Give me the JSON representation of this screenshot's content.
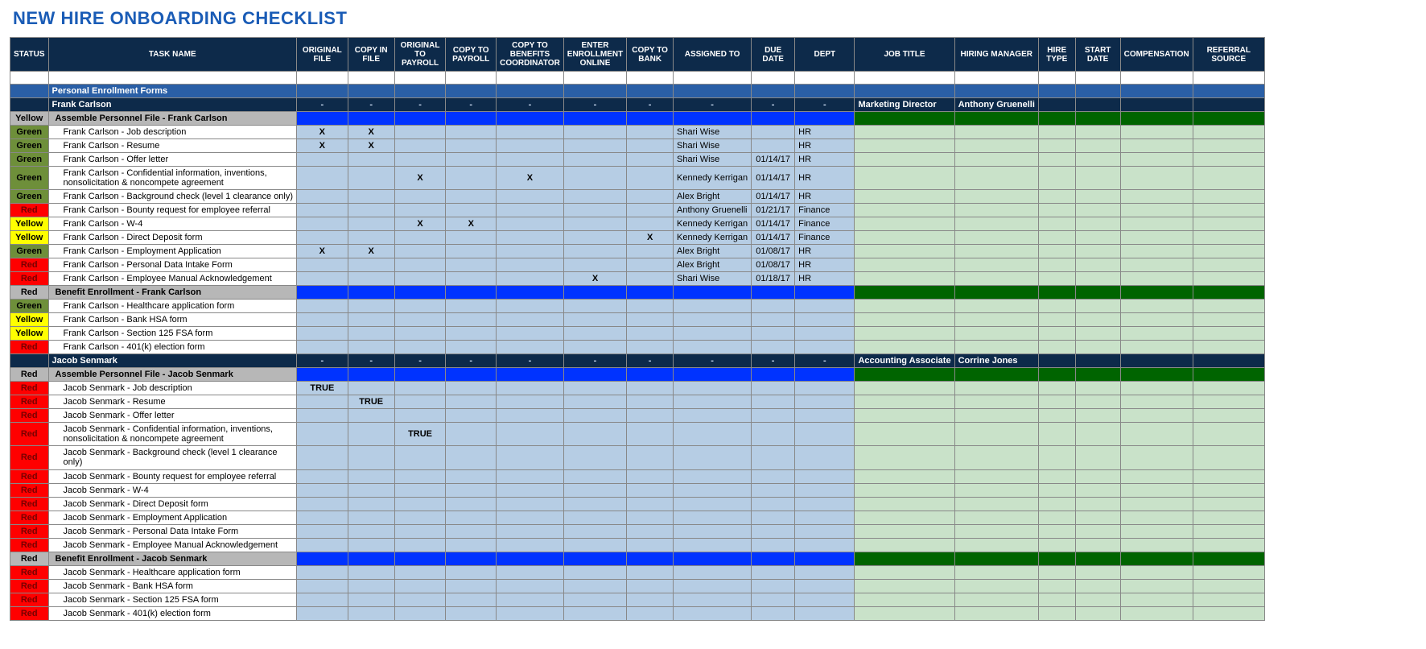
{
  "title": "NEW HIRE ONBOARDING CHECKLIST",
  "headers": [
    "STATUS",
    "TASK NAME",
    "ORIGINAL FILE",
    "COPY IN FILE",
    "ORIGINAL TO PAYROLL",
    "COPY TO PAYROLL",
    "COPY TO BENEFITS COORDINATOR",
    "ENTER ENROLLMENT ONLINE",
    "COPY TO BANK",
    "ASSIGNED TO",
    "DUE DATE",
    "DEPT",
    "JOB TITLE",
    "HIRING MANAGER",
    "HIRE TYPE",
    "START DATE",
    "COMPENSATION",
    "REFERRAL SOURCE"
  ],
  "section_label": "Personal Enrollment Forms",
  "hires": [
    {
      "name": "Frank Carlson",
      "job_title": "Marketing Director",
      "manager": "Anthony Gruenelli",
      "groups": [
        {
          "status": "Yellow",
          "label": "Assemble Personnel File - Frank Carlson",
          "rows": [
            {
              "status": "Green",
              "task": "Frank Carlson - Job description",
              "x": [
                "X",
                "X",
                "",
                "",
                "",
                "",
                ""
              ],
              "assigned": "Shari Wise",
              "date": "",
              "dept": "HR"
            },
            {
              "status": "Green",
              "task": "Frank Carlson - Resume",
              "x": [
                "X",
                "X",
                "",
                "",
                "",
                "",
                ""
              ],
              "assigned": "Shari Wise",
              "date": "",
              "dept": "HR"
            },
            {
              "status": "Green",
              "task": "Frank Carlson - Offer letter",
              "x": [
                "",
                "",
                "",
                "",
                "",
                "",
                ""
              ],
              "assigned": "Shari Wise",
              "date": "01/14/17",
              "dept": "HR"
            },
            {
              "status": "Green",
              "task": "Frank Carlson - Confidential information, inventions, nonsolicitation & noncompete agreement",
              "x": [
                "",
                "",
                "X",
                "",
                "X",
                "",
                ""
              ],
              "assigned": "Kennedy Kerrigan",
              "date": "01/14/17",
              "dept": "HR",
              "wrap": true
            },
            {
              "status": "Green",
              "task": "Frank Carlson - Background check (level 1 clearance only)",
              "x": [
                "",
                "",
                "",
                "",
                "",
                "",
                ""
              ],
              "assigned": "Alex Bright",
              "date": "01/14/17",
              "dept": "HR"
            },
            {
              "status": "Red",
              "task": "Frank Carlson - Bounty request for employee referral",
              "x": [
                "",
                "",
                "",
                "",
                "",
                "",
                ""
              ],
              "assigned": "Anthony Gruenelli",
              "date": "01/21/17",
              "dept": "Finance"
            },
            {
              "status": "Yellow",
              "task": "Frank Carlson - W-4",
              "x": [
                "",
                "",
                "X",
                "X",
                "",
                "",
                ""
              ],
              "assigned": "Kennedy Kerrigan",
              "date": "01/14/17",
              "dept": "Finance"
            },
            {
              "status": "Yellow",
              "task": "Frank Carlson - Direct Deposit form",
              "x": [
                "",
                "",
                "",
                "",
                "",
                "",
                "X"
              ],
              "assigned": "Kennedy Kerrigan",
              "date": "01/14/17",
              "dept": "Finance"
            },
            {
              "status": "Green",
              "task": "Frank Carlson - Employment Application",
              "x": [
                "X",
                "X",
                "",
                "",
                "",
                "",
                ""
              ],
              "assigned": "Alex Bright",
              "date": "01/08/17",
              "dept": "HR"
            },
            {
              "status": "Red",
              "task": "Frank Carlson - Personal Data Intake Form",
              "x": [
                "",
                "",
                "",
                "",
                "",
                "",
                ""
              ],
              "assigned": "Alex Bright",
              "date": "01/08/17",
              "dept": "HR"
            },
            {
              "status": "Red",
              "task": "Frank Carlson - Employee Manual Acknowledgement",
              "x": [
                "",
                "",
                "",
                "",
                "",
                "X",
                ""
              ],
              "assigned": "Shari Wise",
              "date": "01/18/17",
              "dept": "HR"
            }
          ]
        },
        {
          "status": "Red",
          "label": "Benefit Enrollment - Frank Carlson",
          "rows": [
            {
              "status": "Green",
              "task": "Frank Carlson - Healthcare application form",
              "x": [
                "",
                "",
                "",
                "",
                "",
                "",
                ""
              ],
              "assigned": "",
              "date": "",
              "dept": ""
            },
            {
              "status": "Yellow",
              "task": "Frank Carlson - Bank HSA form",
              "x": [
                "",
                "",
                "",
                "",
                "",
                "",
                ""
              ],
              "assigned": "",
              "date": "",
              "dept": ""
            },
            {
              "status": "Yellow",
              "task": "Frank Carlson - Section 125 FSA form",
              "x": [
                "",
                "",
                "",
                "",
                "",
                "",
                ""
              ],
              "assigned": "",
              "date": "",
              "dept": ""
            },
            {
              "status": "Red",
              "task": "Frank Carlson - 401(k) election form",
              "x": [
                "",
                "",
                "",
                "",
                "",
                "",
                ""
              ],
              "assigned": "",
              "date": "",
              "dept": ""
            }
          ]
        }
      ]
    },
    {
      "name": "Jacob Senmark",
      "job_title": "Accounting Associate",
      "manager": "Corrine Jones",
      "groups": [
        {
          "status": "Red",
          "label": "Assemble Personnel File - Jacob Senmark",
          "rows": [
            {
              "status": "Red",
              "task": "Jacob Senmark - Job description",
              "x": [
                "TRUE",
                "",
                "",
                "",
                "",
                "",
                ""
              ],
              "assigned": "",
              "date": "",
              "dept": ""
            },
            {
              "status": "Red",
              "task": "Jacob Senmark - Resume",
              "x": [
                "",
                "TRUE",
                "",
                "",
                "",
                "",
                ""
              ],
              "assigned": "",
              "date": "",
              "dept": ""
            },
            {
              "status": "Red",
              "task": "Jacob Senmark - Offer letter",
              "x": [
                "",
                "",
                "",
                "",
                "",
                "",
                ""
              ],
              "assigned": "",
              "date": "",
              "dept": ""
            },
            {
              "status": "Red",
              "task": "Jacob Senmark - Confidential information, inventions, nonsolicitation & noncompete agreement",
              "x": [
                "",
                "",
                "TRUE",
                "",
                "",
                "",
                ""
              ],
              "assigned": "",
              "date": "",
              "dept": "",
              "wrap": true
            },
            {
              "status": "Red",
              "task": "Jacob Senmark - Background check (level 1 clearance only)",
              "x": [
                "",
                "",
                "",
                "",
                "",
                "",
                ""
              ],
              "assigned": "",
              "date": "",
              "dept": "",
              "wrap": true
            },
            {
              "status": "Red",
              "task": "Jacob Senmark - Bounty request for employee referral",
              "x": [
                "",
                "",
                "",
                "",
                "",
                "",
                ""
              ],
              "assigned": "",
              "date": "",
              "dept": ""
            },
            {
              "status": "Red",
              "task": "Jacob Senmark - W-4",
              "x": [
                "",
                "",
                "",
                "",
                "",
                "",
                ""
              ],
              "assigned": "",
              "date": "",
              "dept": ""
            },
            {
              "status": "Red",
              "task": "Jacob Senmark - Direct Deposit form",
              "x": [
                "",
                "",
                "",
                "",
                "",
                "",
                ""
              ],
              "assigned": "",
              "date": "",
              "dept": ""
            },
            {
              "status": "Red",
              "task": "Jacob Senmark - Employment Application",
              "x": [
                "",
                "",
                "",
                "",
                "",
                "",
                ""
              ],
              "assigned": "",
              "date": "",
              "dept": ""
            },
            {
              "status": "Red",
              "task": "Jacob Senmark - Personal Data Intake Form",
              "x": [
                "",
                "",
                "",
                "",
                "",
                "",
                ""
              ],
              "assigned": "",
              "date": "",
              "dept": ""
            },
            {
              "status": "Red",
              "task": "Jacob Senmark - Employee Manual Acknowledgement",
              "x": [
                "",
                "",
                "",
                "",
                "",
                "",
                ""
              ],
              "assigned": "",
              "date": "",
              "dept": ""
            }
          ]
        },
        {
          "status": "Red",
          "label": "Benefit Enrollment - Jacob Senmark",
          "rows": [
            {
              "status": "Red",
              "task": "Jacob Senmark - Healthcare application form",
              "x": [
                "",
                "",
                "",
                "",
                "",
                "",
                ""
              ],
              "assigned": "",
              "date": "",
              "dept": ""
            },
            {
              "status": "Red",
              "task": "Jacob Senmark - Bank HSA form",
              "x": [
                "",
                "",
                "",
                "",
                "",
                "",
                ""
              ],
              "assigned": "",
              "date": "",
              "dept": ""
            },
            {
              "status": "Red",
              "task": "Jacob Senmark - Section 125 FSA form",
              "x": [
                "",
                "",
                "",
                "",
                "",
                "",
                ""
              ],
              "assigned": "",
              "date": "",
              "dept": ""
            },
            {
              "status": "Red",
              "task": "Jacob Senmark - 401(k) election form",
              "x": [
                "",
                "",
                "",
                "",
                "",
                "",
                ""
              ],
              "assigned": "",
              "date": "",
              "dept": ""
            }
          ]
        }
      ]
    }
  ]
}
